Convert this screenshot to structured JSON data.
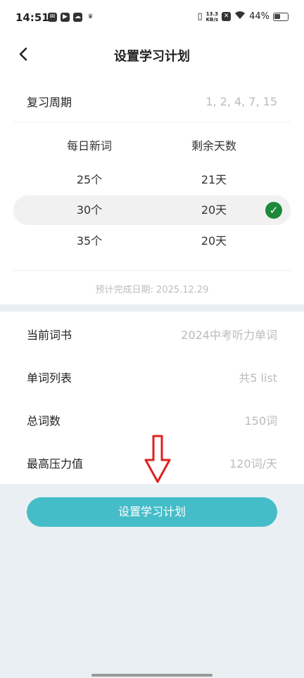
{
  "status_bar": {
    "time": "14:51",
    "net_speed_top": "13.3",
    "net_speed_unit": "KB/s",
    "battery": "44%",
    "left_icons": [
      "mail-icon",
      "play-icon",
      "cloud-icon",
      "crown-icon"
    ],
    "right_icons": [
      "vibrate-icon",
      "close-square-icon",
      "wifi-icon",
      "battery-icon"
    ]
  },
  "header": {
    "title": "设置学习计划",
    "back_icon": "chevron-left-icon"
  },
  "review": {
    "label": "复习周期",
    "value": "1, 2, 4, 7, 15"
  },
  "options_table": {
    "headers": [
      "每日新词",
      "剩余天数"
    ],
    "rows": [
      {
        "daily": "25个",
        "days": "21天",
        "selected": false
      },
      {
        "daily": "30个",
        "days": "20天",
        "selected": true
      },
      {
        "daily": "35个",
        "days": "20天",
        "selected": false
      }
    ],
    "check_icon": "check-circle-icon",
    "check_color": "#1d8a3b"
  },
  "finish_date": "预计完成日期: 2025.12.29",
  "info": [
    {
      "label": "当前词书",
      "value": "2024中考听力单词"
    },
    {
      "label": "单词列表",
      "value": "共5 list"
    },
    {
      "label": "总词数",
      "value": "150词"
    },
    {
      "label": "最高压力值",
      "value": "120词/天"
    }
  ],
  "annotation": {
    "icon": "down-arrow-icon",
    "color": "#e02020"
  },
  "primary_button": {
    "label": "设置学习计划",
    "color": "#45bdc8"
  }
}
